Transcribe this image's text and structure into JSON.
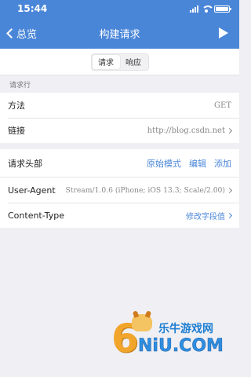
{
  "status_bar": {
    "time": "15:44"
  },
  "nav": {
    "back_label": "总览",
    "title": "构建请求"
  },
  "segments": [
    {
      "label": "请求",
      "active": true
    },
    {
      "label": "响应",
      "active": false
    }
  ],
  "request_line": {
    "section_title": "请求行",
    "method_label": "方法",
    "method_value": "GET",
    "url_label": "链接",
    "url_value": "http://blog.csdn.net"
  },
  "headers": {
    "title": "请求头部",
    "actions": [
      "原始模式",
      "编辑",
      "添加"
    ],
    "rows": [
      {
        "name": "User-Agent",
        "value": "Stream/1.0.6 (iPhone; iOS 13.3; Scale/2.00)"
      },
      {
        "name": "Content-Type",
        "value": "修改字段值"
      }
    ]
  },
  "watermark": {
    "digit": "6",
    "chinese": "乐牛游戏网",
    "latin": "NiU.COM"
  },
  "colors": {
    "accent": "#4a86d8",
    "background": "#efeff4"
  }
}
